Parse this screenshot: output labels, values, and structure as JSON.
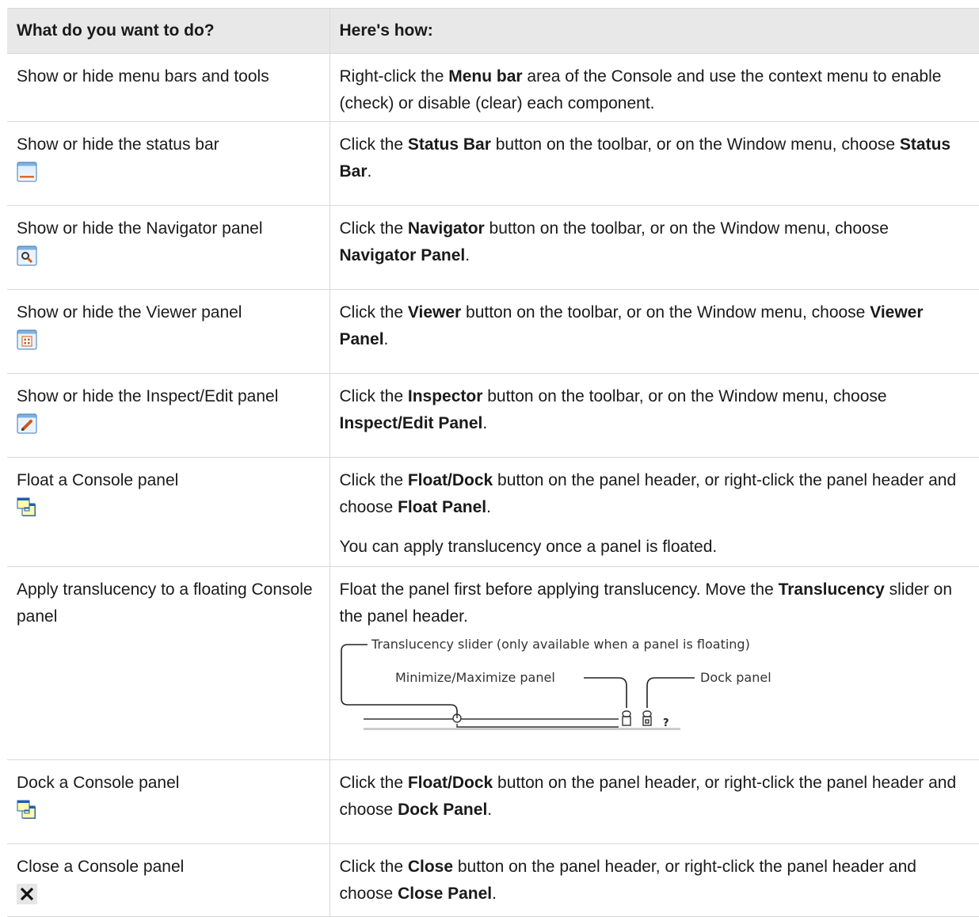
{
  "header": {
    "col1": "What do you want to do?",
    "col2": "Here's how:"
  },
  "rows": [
    {
      "task": "Show or hide menu bars and tools",
      "how": [
        {
          "t": "Right-click the "
        },
        {
          "t": "Menu bar",
          "b": true
        },
        {
          "t": " area of the Console and use the context menu to enable (check) or disable (clear) each component."
        }
      ]
    },
    {
      "task": "Show or hide the status bar",
      "icon": "status-bar-icon",
      "how": [
        {
          "t": "Click the "
        },
        {
          "t": "Status Bar",
          "b": true
        },
        {
          "t": " button on the toolbar, or on the Window menu, choose "
        },
        {
          "t": "Status Bar",
          "b": true
        },
        {
          "t": "."
        }
      ]
    },
    {
      "task": "Show or hide the Navigator panel",
      "icon": "navigator-icon",
      "how": [
        {
          "t": "Click the "
        },
        {
          "t": "Navigator",
          "b": true
        },
        {
          "t": " button on the toolbar, or on the Window menu, choose "
        },
        {
          "t": "Navigator Panel",
          "b": true
        },
        {
          "t": "."
        }
      ]
    },
    {
      "task": "Show or hide the Viewer panel",
      "icon": "viewer-icon",
      "how": [
        {
          "t": "Click the "
        },
        {
          "t": "Viewer",
          "b": true
        },
        {
          "t": " button on the toolbar, or on the Window menu, choose "
        },
        {
          "t": "Viewer Panel",
          "b": true
        },
        {
          "t": "."
        }
      ]
    },
    {
      "task": "Show or hide the Inspect/Edit panel",
      "icon": "inspector-icon",
      "how": [
        {
          "t": "Click the "
        },
        {
          "t": "Inspector",
          "b": true
        },
        {
          "t": " button on the toolbar, or on the Window menu, choose "
        },
        {
          "t": "Inspect/Edit Panel",
          "b": true
        },
        {
          "t": "."
        }
      ]
    },
    {
      "task": "Float a Console panel",
      "icon": "float-dock-icon",
      "how": [
        {
          "t": "Click the "
        },
        {
          "t": "Float/Dock",
          "b": true
        },
        {
          "t": " button on the panel header, or right-click the panel header and choose "
        },
        {
          "t": "Float Panel",
          "b": true
        },
        {
          "t": "."
        }
      ],
      "note": "You can apply translucency once a panel is floated."
    },
    {
      "task": "Apply translucency to a floating Console panel",
      "how": [
        {
          "t": "Float the panel first before applying translucency. Move the "
        },
        {
          "t": "Translucency",
          "b": true
        },
        {
          "t": " slider on the panel header."
        }
      ],
      "diagram": {
        "label_translucency": "Translucency slider (only available when a panel is floating)",
        "label_minmax": "Minimize/Maximize panel",
        "label_dock": "Dock panel",
        "help_glyph": "?"
      }
    },
    {
      "task": "Dock a Console panel",
      "icon": "float-dock-icon",
      "how": [
        {
          "t": "Click the "
        },
        {
          "t": "Float/Dock",
          "b": true
        },
        {
          "t": " button on the panel header, or right-click the panel header and choose "
        },
        {
          "t": "Dock Panel",
          "b": true
        },
        {
          "t": "."
        }
      ]
    },
    {
      "task": "Close a Console panel",
      "icon": "close-icon",
      "how": [
        {
          "t": "Click the "
        },
        {
          "t": "Close",
          "b": true
        },
        {
          "t": " button on the panel header, or right-click the panel header and choose "
        },
        {
          "t": "Close Panel",
          "b": true
        },
        {
          "t": "."
        }
      ]
    }
  ]
}
